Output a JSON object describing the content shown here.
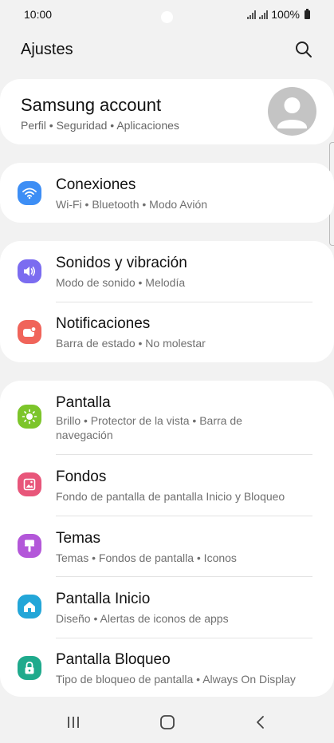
{
  "status": {
    "time": "10:00",
    "battery": "100%"
  },
  "header": {
    "title": "Ajustes"
  },
  "account": {
    "title": "Samsung account",
    "subtitle": "Perfil  •  Seguridad  •  Aplicaciones"
  },
  "sections": {
    "conexiones": {
      "title": "Conexiones",
      "subtitle": "Wi-Fi  •  Bluetooth  •  Modo Avión",
      "color": "#3d8ef5"
    },
    "sonidos": {
      "title": "Sonidos y vibración",
      "subtitle": "Modo de sonido  •  Melodía",
      "color": "#7b6cf0"
    },
    "notificaciones": {
      "title": "Notificaciones",
      "subtitle": "Barra de estado  •  No molestar",
      "color": "#f0645a"
    },
    "pantalla": {
      "title": "Pantalla",
      "subtitle": "Brillo  •  Protector de la vista  •  Barra de navegación",
      "color": "#7cc52a"
    },
    "fondos": {
      "title": "Fondos",
      "subtitle": "Fondo de pantalla de pantalla Inicio y Bloqueo",
      "color": "#e8567a"
    },
    "temas": {
      "title": "Temas",
      "subtitle": "Temas  •  Fondos de pantalla  •  Iconos",
      "color": "#b357d9"
    },
    "inicio": {
      "title": "Pantalla Inicio",
      "subtitle": "Diseño  •  Alertas de iconos de apps",
      "color": "#23a6d8"
    },
    "bloqueo": {
      "title": "Pantalla Bloqueo",
      "subtitle": "Tipo de bloqueo de pantalla  •  Always On Display",
      "color": "#1faa8c"
    }
  }
}
